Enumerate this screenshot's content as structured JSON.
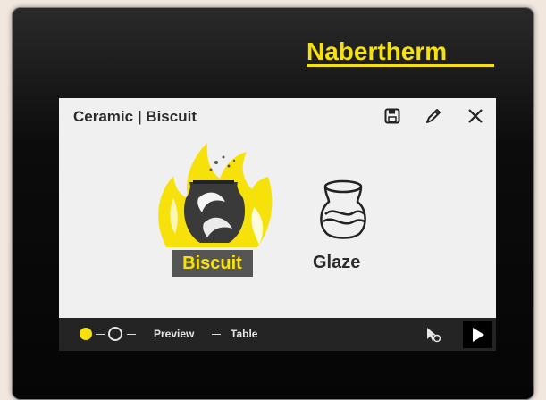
{
  "brand": {
    "logo_text": "Nabertherm"
  },
  "dialog": {
    "title": "Ceramic | Biscuit",
    "icons": {
      "save": "save-icon",
      "edit": "edit-icon",
      "close": "close-icon"
    },
    "options": [
      {
        "label": "Biscuit",
        "selected": true,
        "icon": "biscuit-flame-pot-icon"
      },
      {
        "label": "Glaze",
        "selected": false,
        "icon": "glaze-vase-icon"
      }
    ]
  },
  "bottom_bar": {
    "steps": [
      {
        "kind": "dot",
        "state": "active"
      },
      {
        "kind": "dot",
        "state": "inactive"
      },
      {
        "kind": "text",
        "label": "Preview"
      },
      {
        "kind": "text",
        "label": "Table"
      }
    ],
    "step_preview": "Preview",
    "step_table": "Table",
    "icons": {
      "cursor": "touch-cursor-icon",
      "play": "play-icon"
    }
  },
  "colors": {
    "accent": "#f6e20a",
    "dialog_bg": "#f0f0f0",
    "bezel": "#0a0a0a",
    "selected_label_bg": "#555555"
  }
}
